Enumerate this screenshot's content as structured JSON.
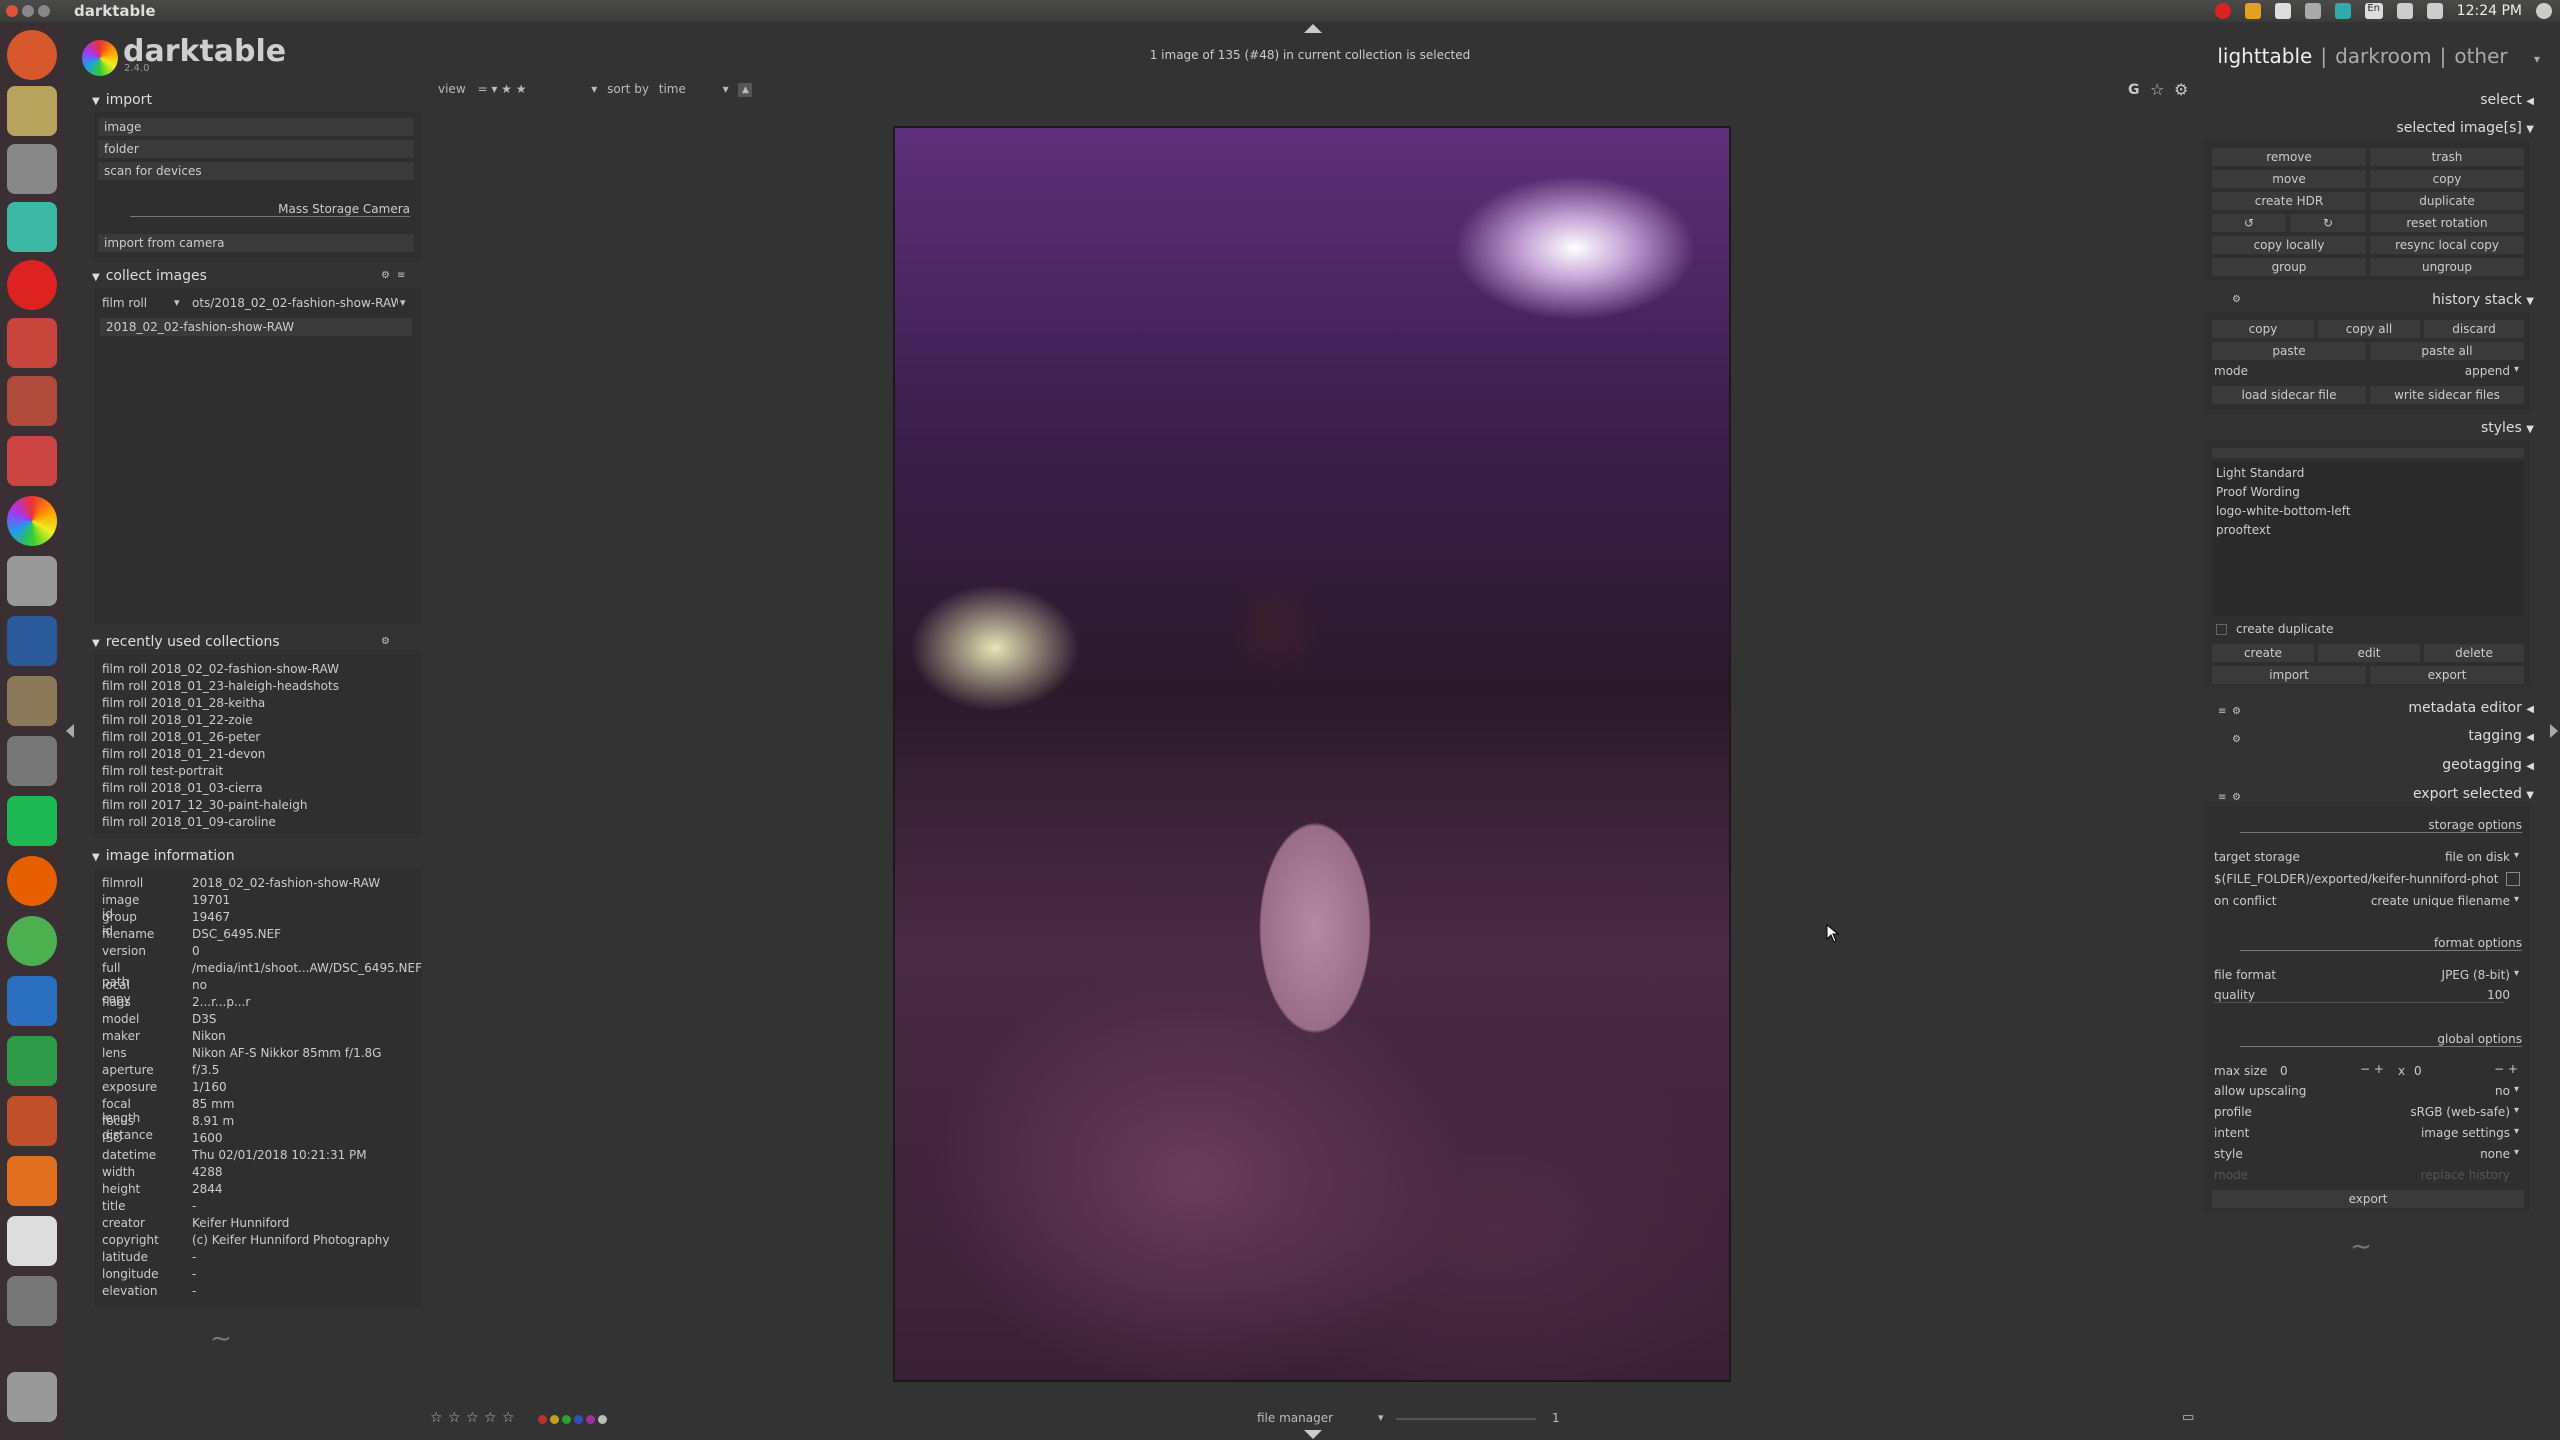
{
  "window": {
    "title": "darktable"
  },
  "tray": {
    "clock": "12:24 PM",
    "lang": "En"
  },
  "app": {
    "logo": "darktable",
    "version": "2.4.0",
    "status": "1 image of 135 (#48) in current collection is selected",
    "views": {
      "lighttable": "lighttable",
      "darkroom": "darkroom",
      "other": "other",
      "sep": "|"
    }
  },
  "toolbar": {
    "view_label": "view",
    "view_value": "= ▾  ★ ★",
    "sortby_label": "sort by",
    "sortby_value": "time"
  },
  "toolbar_icons": [
    "g-icon",
    "star-icon",
    "gear-icon"
  ],
  "left": {
    "import": {
      "title": "import",
      "buttons": [
        "image",
        "folder",
        "scan for devices"
      ],
      "device": "Mass Storage Camera",
      "device_button": "import from camera"
    },
    "collect": {
      "title": "collect images",
      "property": "film roll",
      "path": "ots/2018_02_02-fashion-show-RAW",
      "items": [
        "2018_02_02-fashion-show-RAW"
      ]
    },
    "recent": {
      "title": "recently used collections",
      "items": [
        "film roll 2018_02_02-fashion-show-RAW",
        "film roll 2018_01_23-haleigh-headshots",
        "film roll 2018_01_28-keitha",
        "film roll 2018_01_22-zoie",
        "film roll 2018_01_26-peter",
        "film roll 2018_01_21-devon",
        "film roll test-portrait",
        "film roll 2018_01_03-cierra",
        "film roll 2017_12_30-paint-haleigh",
        "film roll 2018_01_09-caroline"
      ]
    },
    "info": {
      "title": "image information",
      "rows": [
        [
          "filmroll",
          "2018_02_02-fashion-show-RAW"
        ],
        [
          "image id",
          "19701"
        ],
        [
          "group id",
          "19467"
        ],
        [
          "filename",
          "DSC_6495.NEF"
        ],
        [
          "version",
          "0"
        ],
        [
          "full path",
          "/media/int1/shoot...AW/DSC_6495.NEF"
        ],
        [
          "local copy",
          "no"
        ],
        [
          "flags",
          "2...r...p...r"
        ],
        [
          "model",
          "D3S"
        ],
        [
          "maker",
          "Nikon"
        ],
        [
          "lens",
          "Nikon AF-S Nikkor 85mm f/1.8G"
        ],
        [
          "aperture",
          "f/3.5"
        ],
        [
          "exposure",
          "1/160"
        ],
        [
          "focal length",
          "85 mm"
        ],
        [
          "focus distance",
          "8.91 m"
        ],
        [
          "ISO",
          "1600"
        ],
        [
          "datetime",
          "Thu 02/01/2018 10:21:31 PM"
        ],
        [
          "width",
          "4288"
        ],
        [
          "height",
          "2844"
        ],
        [
          "title",
          "-"
        ],
        [
          "creator",
          "Keifer Hunniford"
        ],
        [
          "copyright",
          "(c) Keifer Hunniford Photography"
        ],
        [
          "latitude",
          "-"
        ],
        [
          "longitude",
          "-"
        ],
        [
          "elevation",
          "-"
        ]
      ]
    }
  },
  "bottom": {
    "layout": "file manager",
    "zoom": "1",
    "label_colors": [
      "#c03030",
      "#c0a020",
      "#30a030",
      "#3050c0",
      "#a030a0",
      "#bbbbbb"
    ]
  },
  "right": {
    "select": "select",
    "selected": {
      "title": "selected image[s]",
      "buttons": [
        [
          "remove",
          "trash"
        ],
        [
          "move",
          "copy"
        ],
        [
          "create HDR",
          "duplicate"
        ],
        [
          "reset rotation"
        ],
        [
          "copy locally",
          "resync local copy"
        ],
        [
          "group",
          "ungroup"
        ]
      ]
    },
    "history": {
      "title": "history stack",
      "row1": [
        "copy",
        "copy all",
        "discard"
      ],
      "row2": [
        "paste",
        "paste all"
      ],
      "mode_label": "mode",
      "mode_value": "append",
      "row3": [
        "load sidecar file",
        "write sidecar files"
      ]
    },
    "styles": {
      "title": "styles",
      "items": [
        "Light Standard",
        "Proof Wording",
        "logo-white-bottom-left",
        "prooftext"
      ],
      "create_duplicate": "create duplicate",
      "row1": [
        "create",
        "edit",
        "delete"
      ],
      "row2": [
        "import",
        "export"
      ]
    },
    "metadata": "metadata editor",
    "tagging": "tagging",
    "geotagging": "geotagging",
    "export": {
      "title": "export selected",
      "storage_options": "storage options",
      "target_storage_label": "target storage",
      "target_storage_value": "file on disk",
      "path": "$(FILE_FOLDER)/exported/keifer-hunniford-photogr",
      "on_conflict_label": "on conflict",
      "on_conflict_value": "create unique filename",
      "format_options": "format options",
      "file_format_label": "file format",
      "file_format_value": "JPEG (8-bit)",
      "quality_label": "quality",
      "quality_value": "100",
      "global_options": "global options",
      "max_size_label": "max size",
      "max_w": "0",
      "max_h": "0",
      "x": "x",
      "upscaling_label": "allow upscaling",
      "upscaling_value": "no",
      "profile_label": "profile",
      "profile_value": "sRGB (web-safe)",
      "intent_label": "intent",
      "intent_value": "image settings",
      "style_label": "style",
      "style_value": "none",
      "mode_label": "mode",
      "mode_value": "replace history",
      "export_button": "export"
    }
  }
}
